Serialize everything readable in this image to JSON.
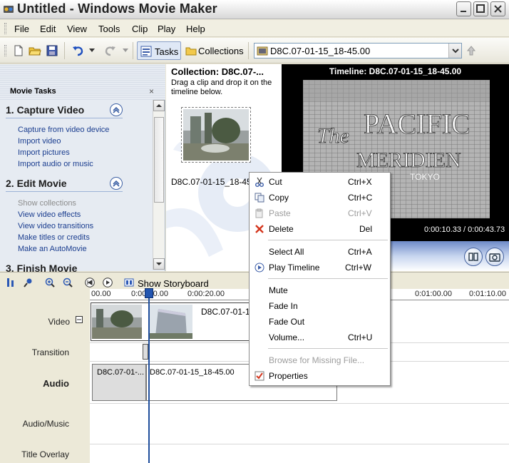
{
  "window": {
    "title": "Untitled - Windows Movie Maker"
  },
  "menu": [
    "File",
    "Edit",
    "View",
    "Tools",
    "Clip",
    "Play",
    "Help"
  ],
  "toolbar": {
    "tasks_label": "Tasks",
    "collections_label": "Collections",
    "collection_selected": "D8C.07-01-15_18-45.00"
  },
  "taskpane": {
    "title": "Movie Tasks",
    "close": "×",
    "sections": [
      {
        "title": "1. Capture Video",
        "links": [
          "Capture from video device",
          "Import video",
          "Import pictures",
          "Import audio or music"
        ]
      },
      {
        "title": "2. Edit Movie",
        "links": [
          "Show collections",
          "View video effects",
          "View video transitions",
          "Make titles or credits",
          "Make an AutoMovie"
        ]
      },
      {
        "title": "3. Finish Movie",
        "links": []
      }
    ]
  },
  "collection": {
    "title": "Collection: D8C.07-...",
    "description": "Drag a clip and drop it on the timeline below.",
    "clip_label": "D8C.07-01-15_18-45"
  },
  "monitor": {
    "title": "Timeline: D8C.07-01-15_18-45.00",
    "time": "0:00:10.33 / 0:00:43.73"
  },
  "timeline": {
    "storyboard_label": "Show Storyboard",
    "ticks": [
      "00.00",
      "0:00:10.00",
      "0:00:20.00",
      "0:01:00.00",
      "0:01:10.00"
    ],
    "tracks": {
      "video": "Video",
      "transition": "Transition",
      "audio": "Audio",
      "audio_music": "Audio/Music",
      "title_overlay": "Title Overlay"
    },
    "video_clip_label": "D8C.07-01-15",
    "audio_clip1": "D8C.07-01-...",
    "audio_clip2": "D8C.07-01-15_18-45.00"
  },
  "context_menu": {
    "items": [
      {
        "label": "Cut",
        "shortcut": "Ctrl+X"
      },
      {
        "label": "Copy",
        "shortcut": "Ctrl+C"
      },
      {
        "label": "Paste",
        "shortcut": "Ctrl+V"
      },
      {
        "label": "Delete",
        "shortcut": "Del"
      },
      {
        "label": "Select All",
        "shortcut": "Ctrl+A"
      },
      {
        "label": "Play Timeline",
        "shortcut": "Ctrl+W"
      },
      {
        "label": "Mute",
        "shortcut": ""
      },
      {
        "label": "Fade In",
        "shortcut": ""
      },
      {
        "label": "Fade Out",
        "shortcut": ""
      },
      {
        "label": "Volume...",
        "shortcut": "Ctrl+U"
      },
      {
        "label": "Browse for Missing File...",
        "shortcut": ""
      },
      {
        "label": "Properties",
        "shortcut": ""
      }
    ]
  }
}
